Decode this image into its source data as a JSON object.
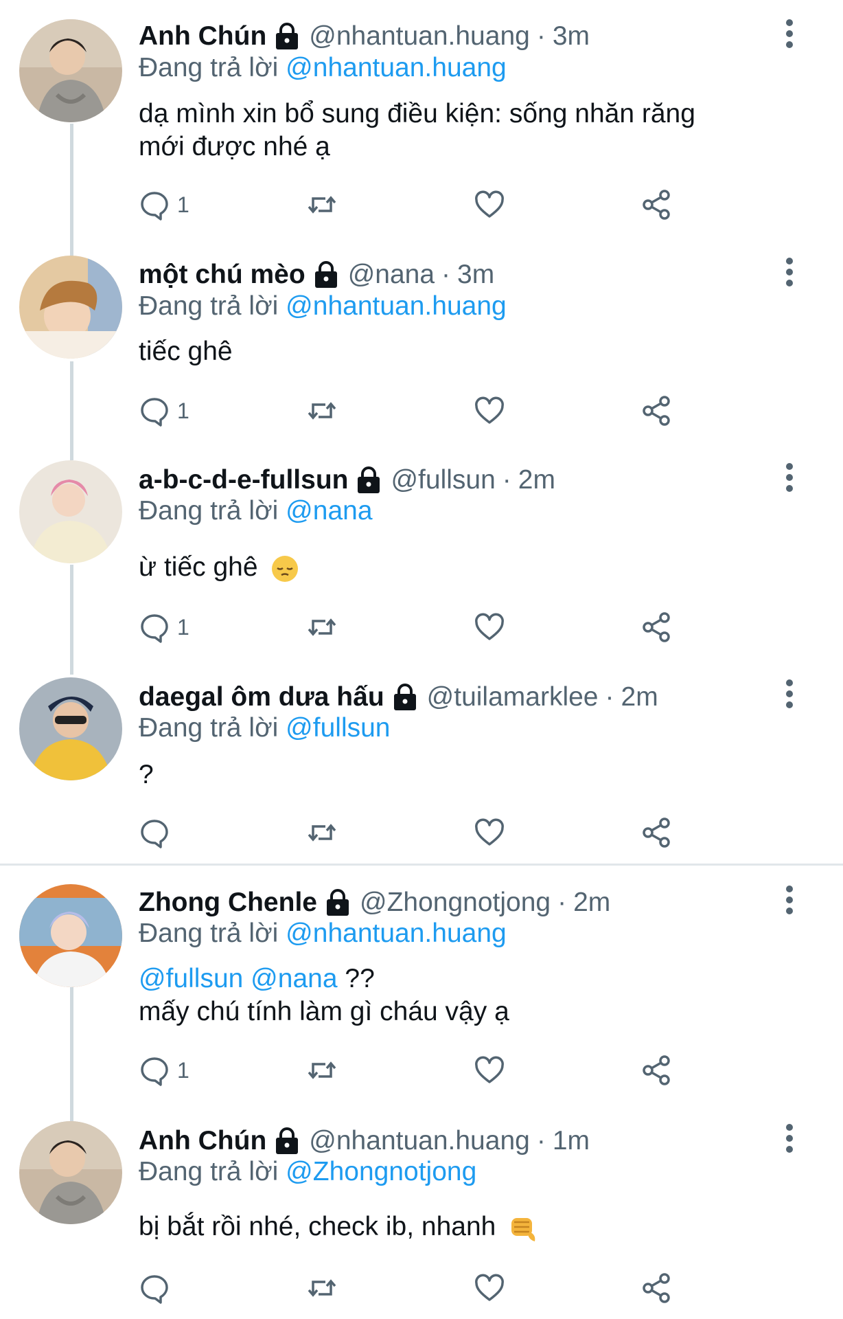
{
  "tweets": [
    {
      "name": "Anh Chún",
      "handle": "@nhantuan.huang",
      "time": "3m",
      "replying_label": "Đang trả lời",
      "replying_to": "@nhantuan.huang",
      "text_line1": "dạ mình xin bổ sung điều kiện: sống nhăn răng",
      "text_line2": "mới được nhé ạ",
      "reply_count": "1"
    },
    {
      "name": "một chú mèo",
      "handle": "@nana",
      "time": "3m",
      "replying_label": "Đang trả lời",
      "replying_to": "@nhantuan.huang",
      "text_line1": "tiếc ghê",
      "reply_count": "1"
    },
    {
      "name": "a-b-c-d-e-fullsun",
      "handle": "@fullsun",
      "time": "2m",
      "replying_label": "Đang trả lời",
      "replying_to": "@nana",
      "text_line1": "ừ tiếc ghê",
      "emoji": "pensive-face",
      "reply_count": "1"
    },
    {
      "name": "daegal ôm dưa hấu",
      "handle": "@tuilamarklee",
      "time": "2m",
      "replying_label": "Đang trả lời",
      "replying_to": "@fullsun",
      "text_line1": "?",
      "reply_count": ""
    },
    {
      "name": "Zhong Chenle",
      "handle": "@Zhongnotjong",
      "time": "2m",
      "replying_label": "Đang trả lời",
      "replying_to": "@nhantuan.huang",
      "mention1": "@fullsun",
      "mention2": "@nana",
      "text_suffix": "??",
      "text_line2": "mấy chú tính làm gì cháu vậy ạ",
      "reply_count": "1"
    },
    {
      "name": "Anh Chún",
      "handle": "@nhantuan.huang",
      "time": "1m",
      "replying_label": "Đang trả lời",
      "replying_to": "@Zhongnotjong",
      "text_line1": "bị bắt rồi nhé, check ib, nhanh",
      "emoji": "thumbs-down-hand",
      "reply_count": ""
    }
  ],
  "separator": "·",
  "colors": {
    "mention": "#1d9bf0",
    "secondary": "#536471",
    "thread_line": "#cfd9de"
  }
}
